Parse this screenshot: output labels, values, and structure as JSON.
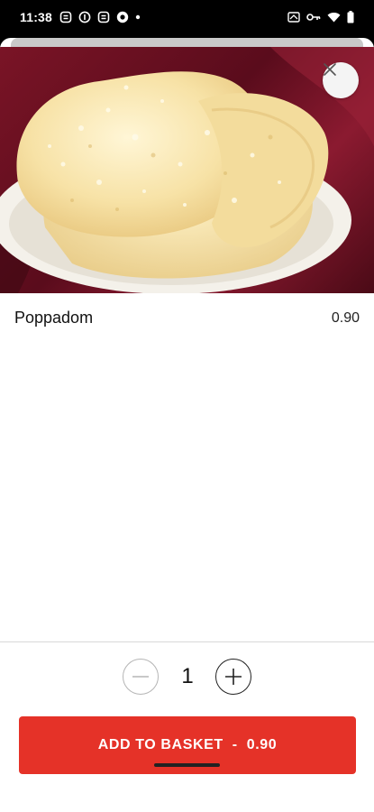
{
  "status_bar": {
    "time": "11:38",
    "left_icons": [
      "sync-icon",
      "info-icon",
      "sync-icon",
      "record-icon",
      "dot-icon"
    ],
    "right_icons": [
      "cast-icon",
      "vpn-key-icon",
      "wifi-icon",
      "battery-icon"
    ]
  },
  "item": {
    "name": "Poppadom",
    "price": "0.90",
    "image": "poppadom-photo"
  },
  "quantity": {
    "value": "1"
  },
  "add_button": {
    "label": "ADD TO BASKET",
    "separator": "-",
    "price": "0.90"
  },
  "colors": {
    "accent": "#e53228",
    "background": "#ffffff",
    "hero_bg": "#6e1224"
  }
}
